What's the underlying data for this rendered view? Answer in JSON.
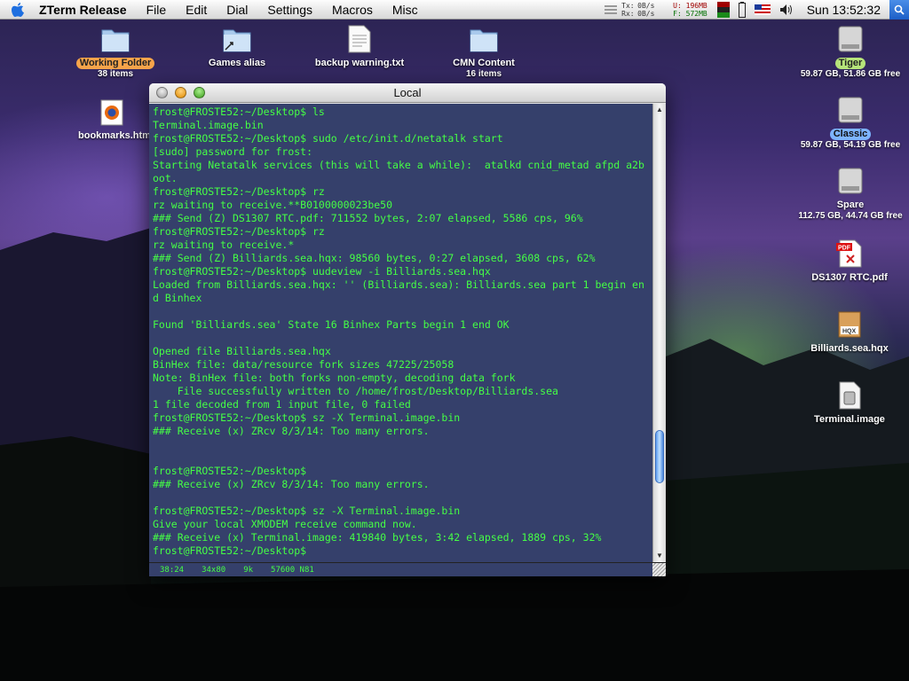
{
  "menubar": {
    "app_name": "ZTerm Release",
    "items": [
      "File",
      "Edit",
      "Dial",
      "Settings",
      "Macros",
      "Misc"
    ],
    "net": {
      "tx_label": "Tx:",
      "rx_label": "Rx:",
      "tx_value": "0B/s",
      "rx_value": "0B/s"
    },
    "mem": {
      "used": "U: 196MB",
      "free": "F: 572MB"
    },
    "clock": "Sun 13:52:32"
  },
  "desktop_icons": {
    "working_folder": {
      "label": "Working Folder",
      "sub": "38 items"
    },
    "games_alias": {
      "label": "Games alias"
    },
    "backup_warning": {
      "label": "backup warning.txt"
    },
    "cmn_content": {
      "label": "CMN Content",
      "sub": "16 items"
    },
    "bookmarks": {
      "label": "bookmarks.htm"
    },
    "tiger": {
      "label": "Tiger",
      "sub": "59.87 GB, 51.86 GB free"
    },
    "classic": {
      "label": "Classic",
      "sub": "59.87 GB, 54.19 GB free"
    },
    "spare": {
      "label": "Spare",
      "sub": "112.75 GB, 44.74 GB free"
    },
    "ds1307": {
      "label": "DS1307 RTC.pdf",
      "badge": "PDF"
    },
    "billiards": {
      "label": "Billiards.sea.hqx",
      "badge": "HQX"
    },
    "terminal_image": {
      "label": "Terminal.image"
    }
  },
  "window": {
    "title": "Local",
    "lines": [
      "frost@FROSTE52:~/Desktop$ ls",
      "Terminal.image.bin",
      "frost@FROSTE52:~/Desktop$ sudo /etc/init.d/netatalk start",
      "[sudo] password for frost:",
      "Starting Netatalk services (this will take a while):  atalkd cnid_metad afpd a2b",
      "oot.",
      "frost@FROSTE52:~/Desktop$ rz",
      "rz waiting to receive.**B0100000023be50",
      "### Send (Z) DS1307 RTC.pdf: 711552 bytes, 2:07 elapsed, 5586 cps, 96%",
      "frost@FROSTE52:~/Desktop$ rz",
      "rz waiting to receive.*",
      "### Send (Z) Billiards.sea.hqx: 98560 bytes, 0:27 elapsed, 3608 cps, 62%",
      "frost@FROSTE52:~/Desktop$ uudeview -i Billiards.sea.hqx",
      "Loaded from Billiards.sea.hqx: '' (Billiards.sea): Billiards.sea part 1 begin en",
      "d Binhex",
      "",
      "Found 'Billiards.sea' State 16 Binhex Parts begin 1 end OK",
      "",
      "Opened file Billiards.sea.hqx",
      "BinHex file: data/resource fork sizes 47225/25058",
      "Note: BinHex file: both forks non-empty, decoding data fork",
      "    File successfully written to /home/frost/Desktop/Billiards.sea",
      "1 file decoded from 1 input file, 0 failed",
      "frost@FROSTE52:~/Desktop$ sz -X Terminal.image.bin",
      "### Receive (x) ZRcv 8/3/14: Too many errors.",
      "",
      "",
      "frost@FROSTE52:~/Desktop$",
      "### Receive (x) ZRcv 8/3/14: Too many errors.",
      "",
      "frost@FROSTE52:~/Desktop$ sz -X Terminal.image.bin",
      "Give your local XMODEM receive command now.",
      "### Receive (x) Terminal.image: 419840 bytes, 3:42 elapsed, 1889 cps, 32%",
      "frost@FROSTE52:~/Desktop$"
    ],
    "status": [
      "38:24",
      "34x80",
      "9k",
      "57600 N81"
    ]
  }
}
